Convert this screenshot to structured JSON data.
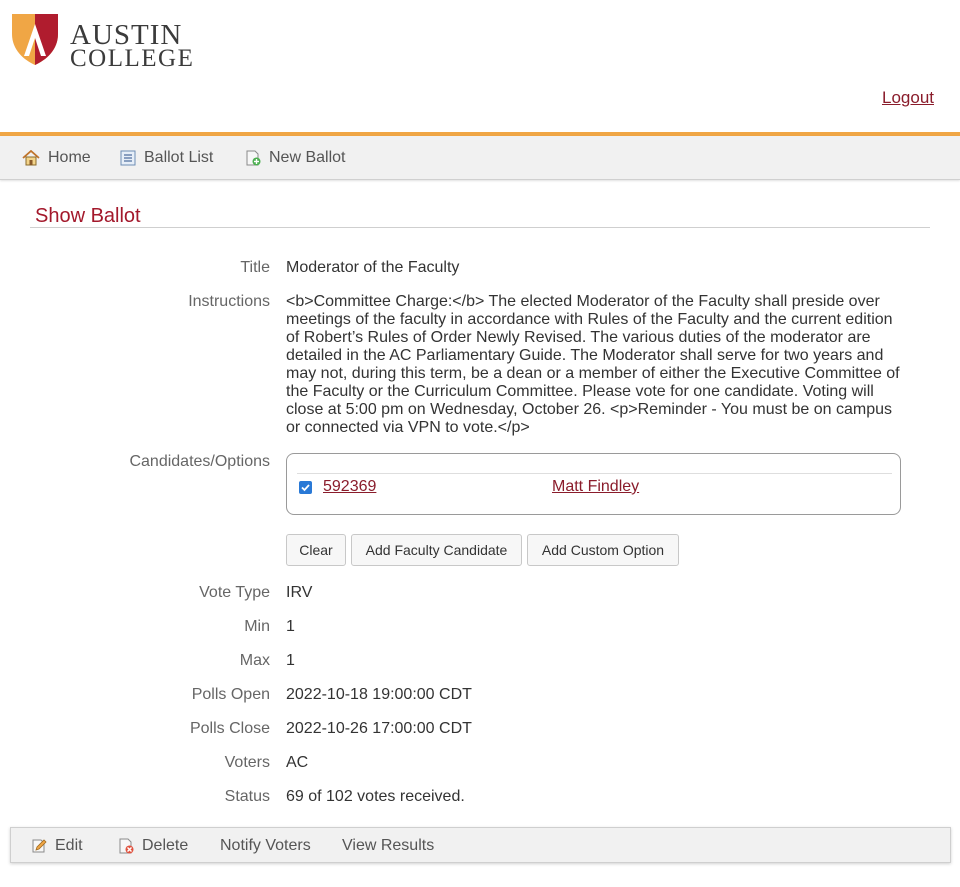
{
  "header": {
    "logo_line1": "AUSTIN",
    "logo_line2": "COLLEGE",
    "logout_label": "Logout"
  },
  "nav": {
    "items": [
      {
        "label": "Home",
        "icon": "home-icon"
      },
      {
        "label": "Ballot List",
        "icon": "list-icon"
      },
      {
        "label": "New Ballot",
        "icon": "new-document-icon"
      }
    ]
  },
  "page": {
    "title": "Show Ballot"
  },
  "ballot": {
    "fields": {
      "title_label": "Title",
      "title_value": "Moderator of the Faculty",
      "instructions_label": "Instructions",
      "instructions_value": "<b>Committee Charge:</b> The elected Moderator of the Faculty shall preside over meetings of the faculty in accordance with Rules of the Faculty and the current edition of Robert’s Rules of Order Newly Revised. The various duties of the moderator are detailed in the AC Parliamentary Guide. The Moderator shall serve for two years and may not, during this term, be a dean or a member of either the Executive Committee of the Faculty or the Curriculum Committee. Please vote for one candidate. Voting will close at 5:00 pm on Wednesday, October 26. <p>Reminder - You must be on campus or connected via VPN to vote.</p>",
      "candidates_label": "Candidates/Options",
      "vote_type_label": "Vote Type",
      "vote_type_value": "IRV",
      "min_label": "Min",
      "min_value": "1",
      "max_label": "Max",
      "max_value": "1",
      "polls_open_label": "Polls Open",
      "polls_open_value": "2022-10-18 19:00:00 CDT",
      "polls_close_label": "Polls Close",
      "polls_close_value": "2022-10-26 17:00:00 CDT",
      "voters_label": "Voters",
      "voters_value": "AC",
      "status_label": "Status",
      "status_value": "69 of 102 votes received."
    },
    "candidates": [
      {
        "id": "592369",
        "name": "Matt Findley",
        "checked": true
      }
    ],
    "buttons": {
      "clear": "Clear",
      "add_faculty": "Add Faculty Candidate",
      "add_custom": "Add Custom Option"
    }
  },
  "toolbar": {
    "edit": "Edit",
    "delete": "Delete",
    "notify": "Notify Voters",
    "results": "View Results"
  },
  "colors": {
    "accent": "#a3182b",
    "link": "#8a1c2b",
    "orange_bar": "#f0a645",
    "logo_orange": "#f0a645",
    "logo_red": "#b01c2e",
    "checkbox": "#2979d6"
  }
}
